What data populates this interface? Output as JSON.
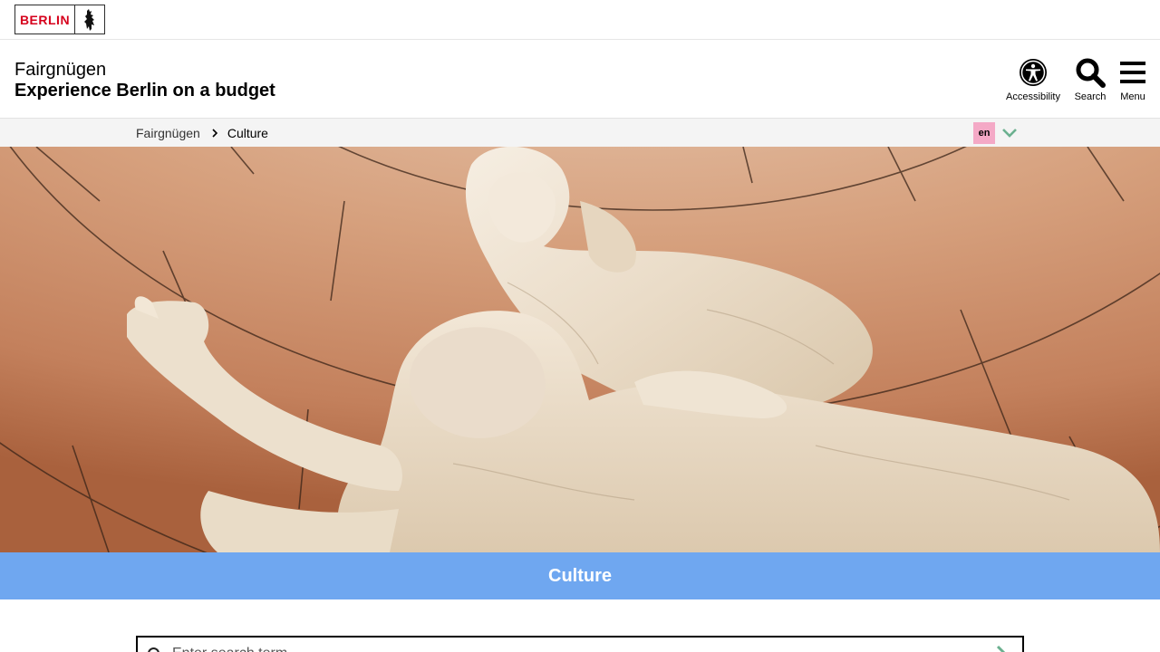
{
  "brand": {
    "logo_text": "BERLIN",
    "logo_color": "#d6001c"
  },
  "header": {
    "site_name": "Fairgnügen",
    "tagline": "Experience Berlin on a budget",
    "tools": {
      "accessibility": "Accessibility",
      "search": "Search",
      "menu": "Menu"
    }
  },
  "breadcrumb": {
    "home": "Fairgnügen",
    "current": "Culture",
    "language": "en",
    "language_badge_color": "#f4a9c6",
    "toggle_color": "#6bb08f"
  },
  "hero": {
    "icon": "marble-sculpture-photo"
  },
  "band": {
    "title": "Culture",
    "color": "#6fa7f0"
  },
  "search": {
    "placeholder": "Enter search term",
    "icon": "search-icon",
    "submit_icon": "chevron-right-icon"
  }
}
